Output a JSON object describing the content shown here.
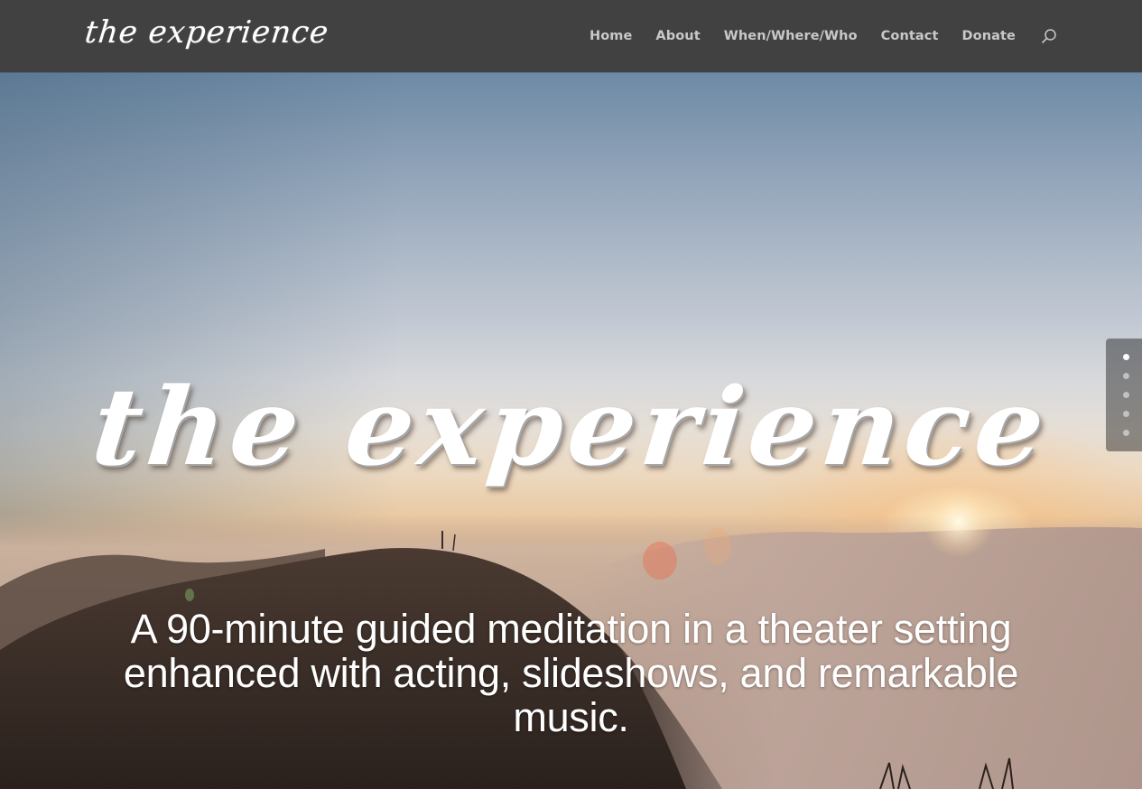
{
  "header": {
    "logo_text": "the experience",
    "nav": [
      {
        "label": "Home"
      },
      {
        "label": "About"
      },
      {
        "label": "When/Where/Who"
      },
      {
        "label": "Contact"
      },
      {
        "label": "Donate"
      }
    ],
    "search_icon": "search-icon"
  },
  "hero": {
    "title": "the experience",
    "subtitle": "A 90-minute guided meditation in a theater setting enhanced with acting, slideshows, and remarkable music."
  },
  "slider": {
    "dots": [
      {
        "label": "0",
        "active": true
      },
      {
        "label": "1",
        "active": false
      },
      {
        "label": "2",
        "active": false
      },
      {
        "label": "3",
        "active": false
      },
      {
        "label": "4",
        "active": false
      }
    ]
  },
  "colors": {
    "header_bg": "#414141",
    "nav_text": "#c9c9c9",
    "hero_text": "#ffffff",
    "dot_active": "#ffffff"
  }
}
